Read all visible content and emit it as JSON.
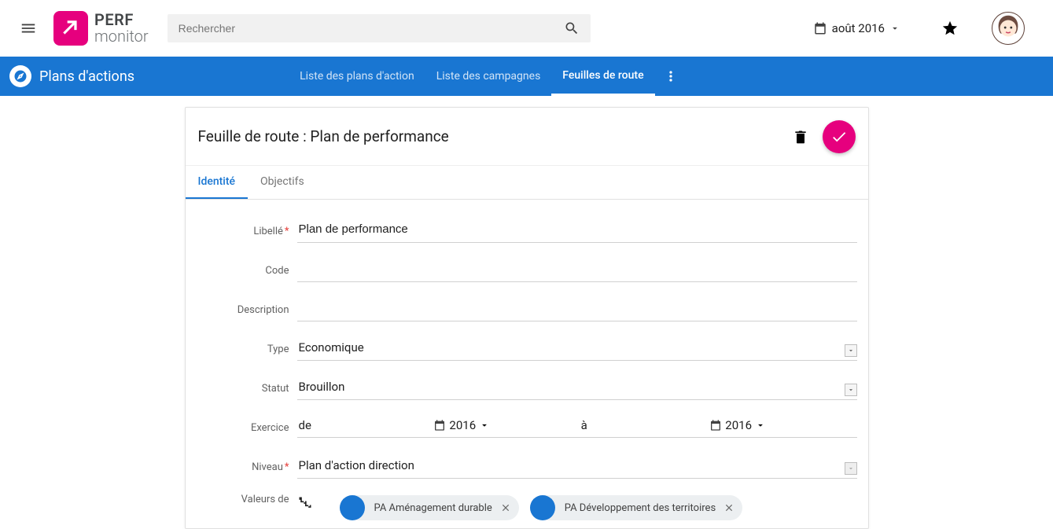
{
  "header": {
    "logo_line1": "PERF",
    "logo_line2": "monitor",
    "search_placeholder": "Rechercher",
    "date_label": "août 2016"
  },
  "nav": {
    "title": "Plans d'actions",
    "tabs": [
      {
        "label": "Liste des plans d'action"
      },
      {
        "label": "Liste des campagnes"
      },
      {
        "label": "Feuilles de route"
      }
    ]
  },
  "card": {
    "title": "Feuille de route : Plan de performance",
    "tabs": [
      {
        "label": "Identité"
      },
      {
        "label": "Objectifs"
      }
    ]
  },
  "form": {
    "libelle": {
      "label": "Libellé",
      "value": "Plan de performance"
    },
    "code": {
      "label": "Code",
      "value": ""
    },
    "description": {
      "label": "Description",
      "value": ""
    },
    "type": {
      "label": "Type",
      "value": "Economique"
    },
    "statut": {
      "label": "Statut",
      "value": "Brouillon"
    },
    "exercice": {
      "label": "Exercice",
      "from_word": "de",
      "from_year": "2016",
      "to_word": "à",
      "to_year": "2016"
    },
    "niveau": {
      "label": "Niveau",
      "value": "Plan d'action direction"
    },
    "valeurs": {
      "label": "Valeurs de",
      "chips": [
        {
          "label": "PA Aménagement durable"
        },
        {
          "label": "PA Développement des territoires"
        }
      ]
    }
  }
}
